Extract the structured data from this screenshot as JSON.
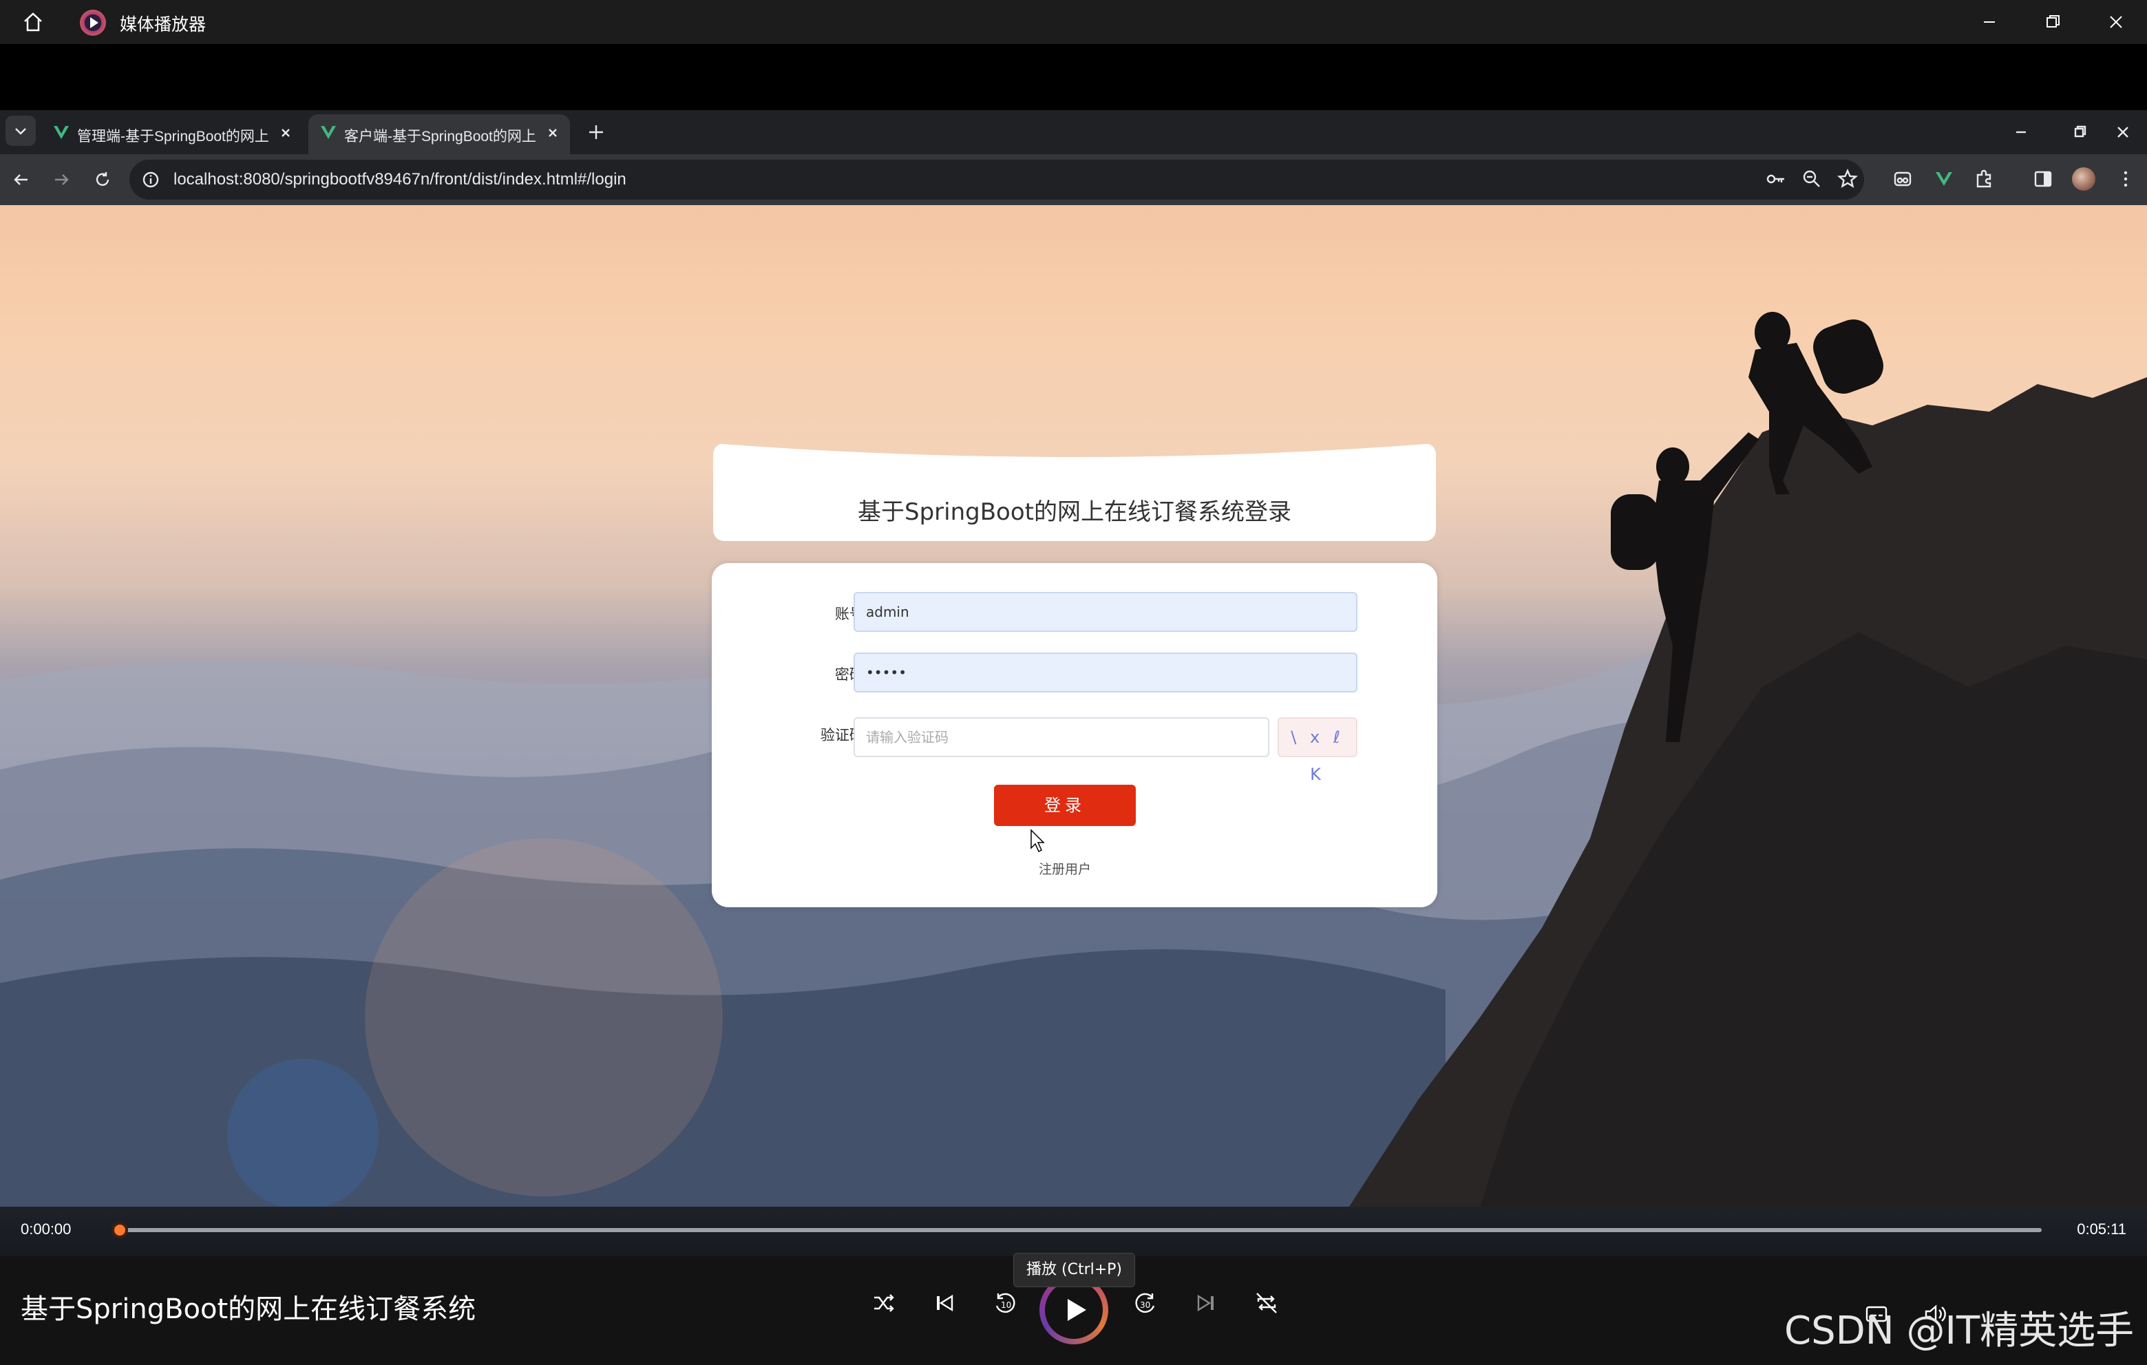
{
  "player": {
    "app_title": "媒体播放器",
    "video_title": "基于SpringBoot的网上在线订餐系统",
    "current_time": "0:00:00",
    "total_time": "0:05:11",
    "progress": 0.0,
    "play_tooltip": "播放 (Ctrl+P)",
    "accent_color": "#ff7a30"
  },
  "browser": {
    "tabs": [
      {
        "label": "管理端-基于SpringBoot的网上",
        "active": false,
        "icon": "vue-icon"
      },
      {
        "label": "客户端-基于SpringBoot的网上",
        "active": true,
        "icon": "vue-icon"
      }
    ],
    "url": "localhost:8080/springbootfv89467n/front/dist/index.html#/login"
  },
  "login": {
    "title": "基于SpringBoot的网上在线订餐系统登录",
    "account_label": "账号:",
    "account_value": "admin",
    "password_label": "密码:",
    "password_value": "•••••",
    "captcha_label": "验证码:",
    "captcha_placeholder": "请输入验证码",
    "captcha_text": "\\ x ℓ K",
    "login_button": "登录",
    "register_link": "注册用户",
    "button_color": "#e02c10"
  },
  "watermark": "CSDN @IT精英选手"
}
